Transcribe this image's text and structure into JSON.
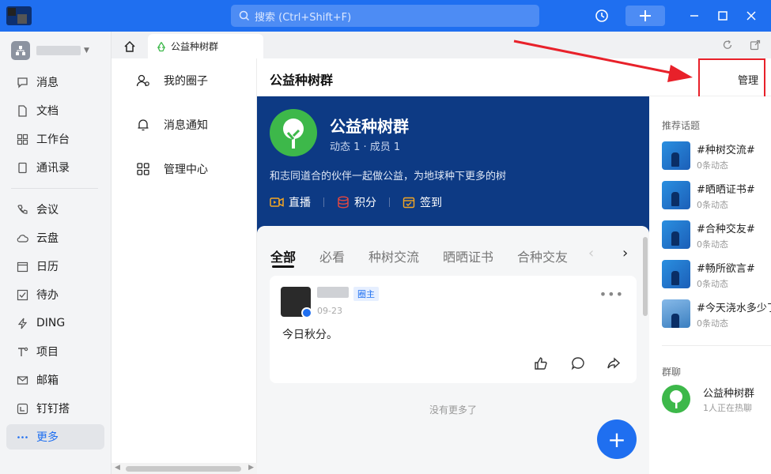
{
  "titlebar": {
    "search_placeholder": "搜索 (Ctrl+Shift+F)"
  },
  "leftnav": {
    "items": [
      {
        "label": "消息",
        "icon": "message-icon"
      },
      {
        "label": "文档",
        "icon": "document-icon"
      },
      {
        "label": "工作台",
        "icon": "workbench-icon"
      },
      {
        "label": "通讯录",
        "icon": "contacts-icon"
      },
      {
        "label": "会议",
        "icon": "meeting-icon"
      },
      {
        "label": "云盘",
        "icon": "cloud-icon"
      },
      {
        "label": "日历",
        "icon": "calendar-icon"
      },
      {
        "label": "待办",
        "icon": "todo-icon"
      },
      {
        "label": "DING",
        "icon": "ding-icon"
      },
      {
        "label": "项目",
        "icon": "project-icon"
      },
      {
        "label": "邮箱",
        "icon": "mail-icon"
      },
      {
        "label": "钉钉搭",
        "icon": "builder-icon"
      },
      {
        "label": "更多",
        "icon": "more-icon",
        "active": true
      }
    ]
  },
  "tabs": {
    "active_tab": "公益种树群"
  },
  "subnav": {
    "items": [
      {
        "label": "我的圈子",
        "icon": "circle-users-icon"
      },
      {
        "label": "消息通知",
        "icon": "bell-icon"
      },
      {
        "label": "管理中心",
        "icon": "grid-icon"
      }
    ]
  },
  "main": {
    "title": "公益种树群",
    "manage_label": "管理",
    "banner": {
      "name": "公益种树群",
      "stats": "动态 1 · 成员 1",
      "description": "和志同道合的伙伴一起做公益，为地球种下更多的树",
      "actions": [
        {
          "label": "直播",
          "icon": "live-icon"
        },
        {
          "label": "积分",
          "icon": "points-icon"
        },
        {
          "label": "签到",
          "icon": "checkin-icon"
        }
      ]
    },
    "feed_tabs": [
      "全部",
      "必看",
      "种树交流",
      "晒晒证书",
      "合种交友"
    ],
    "post": {
      "role": "圈主",
      "date": "09-23",
      "text": "今日秋分。"
    },
    "no_more": "没有更多了",
    "fab": "+"
  },
  "rightpanel": {
    "topics_title": "推荐话题",
    "topics": [
      {
        "name": "#种树交流#",
        "count": "0条动态"
      },
      {
        "name": "#晒晒证书#",
        "count": "0条动态"
      },
      {
        "name": "#合种交友#",
        "count": "0条动态"
      },
      {
        "name": "#畅所欲言#",
        "count": "0条动态"
      },
      {
        "name": "#今天浇水多少了",
        "count": "0条动态"
      }
    ],
    "chat_title": "群聊",
    "chat": {
      "name": "公益种树群",
      "status": "1人正在热聊"
    }
  },
  "colors": {
    "brand_blue": "#1f6ff0",
    "banner_navy": "#0d3a84",
    "tree_green": "#3db84a",
    "highlight_red": "#e8212a"
  }
}
